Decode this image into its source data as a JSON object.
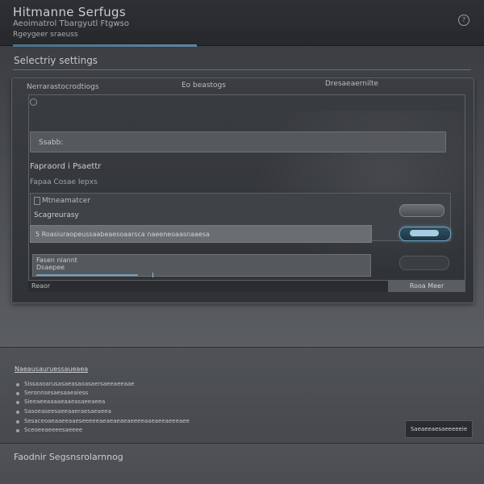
{
  "header": {
    "title": "Hitmanne Serfugs",
    "subtitle": "Aeoimatrol  Tbargyutl Ftgwso",
    "subtitle2": "Rgeygeer sraeuss",
    "help_icon": "help-icon"
  },
  "section": {
    "title": "Selectriy settings"
  },
  "tabs": [
    {
      "label": "Nerrarastocrodtiogs"
    },
    {
      "label": "Eo beastogs"
    },
    {
      "label": "Dresaeaernilte"
    }
  ],
  "search": {
    "value": "Ssabb:"
  },
  "group": {
    "label": "Fapraord i Psaettr",
    "sublabel": "Fapaa Cosae  Iepxs"
  },
  "card": {
    "title": "Mtneamatcer",
    "subtitle": "Scagreurasy"
  },
  "option_row": {
    "label": "5 Roasiuraopeussaabeaesoaarsca  naeeneoaasnaaesa"
  },
  "text_area": {
    "value": "Fasen niannt",
    "value2": "Dsaepee"
  },
  "footer": {
    "left": "Reaor",
    "right": "Rooa Meer"
  },
  "list": {
    "title": "Naeausauruessaueaea",
    "items": [
      "Sissaaoarusasaeasaoasaersaeeaeeaae",
      "Seronnsesaesaaeaiess",
      "Sieeaeeaaaaeaaeasaeeaeea",
      "Sasoeaseesaeeaaeraesaeaeea",
      "Sesaceoaeaaeeaaeseeeeeaeaeaeaeaeeeeaaeaeeaeeeaee",
      "Sceoeeaeeeesaeeee"
    ]
  },
  "help_button": {
    "label": "Saeaeeaesaeeeeeie"
  },
  "bottom": {
    "title": "Faodnir Segsnsrolarnnog"
  }
}
